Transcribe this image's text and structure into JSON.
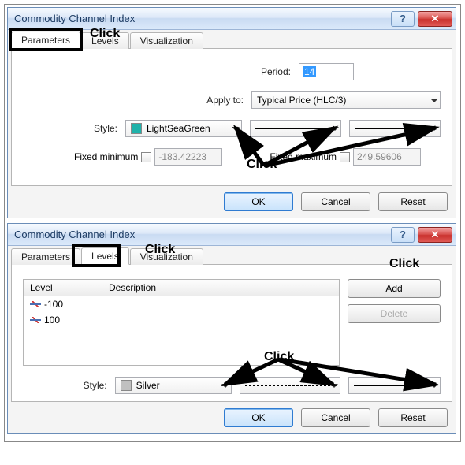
{
  "dialog1": {
    "title": "Commodity Channel Index",
    "tabs": [
      "Parameters",
      "Levels",
      "Visualization"
    ],
    "active_tab": 0,
    "period_label": "Period:",
    "period_value": "14",
    "applyto_label": "Apply to:",
    "applyto_value": "Typical Price (HLC/3)",
    "style_label": "Style:",
    "style_color_name": "LightSeaGreen",
    "style_color_hex": "#20B2AA",
    "fixed_min_label": "Fixed minimum",
    "fixed_min_value": "-183.42223",
    "fixed_max_label": "Fixed maximum",
    "fixed_max_value": "249.59606",
    "buttons": {
      "ok": "OK",
      "cancel": "Cancel",
      "reset": "Reset"
    },
    "annotations": {
      "tab": "Click",
      "style": "Click"
    }
  },
  "dialog2": {
    "title": "Commodity Channel Index",
    "tabs": [
      "Parameters",
      "Levels",
      "Visualization"
    ],
    "active_tab": 1,
    "columns": {
      "level": "Level",
      "description": "Description"
    },
    "rows": [
      {
        "level": "-100",
        "description": ""
      },
      {
        "level": "100",
        "description": ""
      }
    ],
    "add_label": "Add",
    "delete_label": "Delete",
    "style_label": "Style:",
    "style_color_name": "Silver",
    "style_color_hex": "#C0C0C0",
    "buttons": {
      "ok": "OK",
      "cancel": "Cancel",
      "reset": "Reset"
    },
    "annotations": {
      "tab": "Click",
      "add": "Click",
      "style": "Click"
    }
  }
}
